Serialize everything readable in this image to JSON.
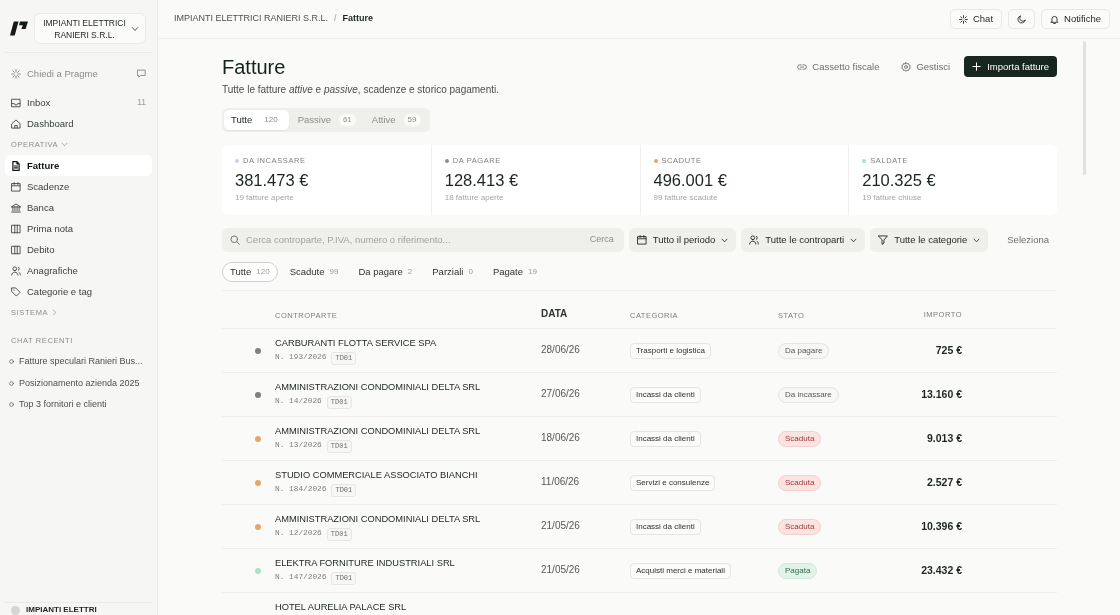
{
  "sidebar": {
    "company": {
      "name": "IMPIANTI ELETTRICI RANIERI S.R.L."
    },
    "ask": {
      "label": "Chiedi a Pragme"
    },
    "items": [
      {
        "label": "Inbox",
        "count": "11",
        "selected": false
      },
      {
        "label": "Dashboard",
        "selected": false
      }
    ],
    "sections": [
      {
        "title": "OPERATIVA",
        "expanded": true,
        "items": [
          {
            "label": "Fatture",
            "selected": true
          },
          {
            "label": "Scadenze",
            "selected": false
          },
          {
            "label": "Banca",
            "selected": false
          },
          {
            "label": "Prima nota",
            "selected": false
          },
          {
            "label": "Debito",
            "selected": false
          },
          {
            "label": "Anagrafiche",
            "selected": false
          },
          {
            "label": "Categorie e tag",
            "selected": false
          }
        ]
      },
      {
        "title": "SISTEMA",
        "expanded": false
      }
    ],
    "recent_chats": {
      "title": "CHAT RECENTI",
      "items": [
        "Fatture speculari Ranieri Bus...",
        "Posizionamento azienda 2025",
        "Top 3 fornitori e clienti"
      ]
    },
    "account": {
      "label": "IMPIANTI ELETTRI"
    }
  },
  "header": {
    "breadcrumb": [
      "IMPIANTI ELETTRICI RANIERI S.R.L.",
      "Fatture"
    ],
    "separator": "/",
    "chat_button": "Chat",
    "notifications_button": "Notifiche"
  },
  "page": {
    "title": "Fatture",
    "subtitle": "Tutte le fatture *attive* e *passive*, scadenze e storico pagamenti.",
    "actions": [
      {
        "label": "Cassetto fiscale",
        "kind": "link"
      },
      {
        "label": "Gestisci",
        "kind": "link"
      },
      {
        "label": "Importa fatture",
        "kind": "primary"
      }
    ]
  },
  "type_tabs": [
    {
      "label": "Tutte",
      "count": "120",
      "selected": true
    },
    {
      "label": "Passive",
      "count": "61",
      "selected": false
    },
    {
      "label": "Attive",
      "count": "59",
      "selected": false
    }
  ],
  "summary": [
    {
      "label": "DA INCASSARE",
      "value": "381.473 €",
      "note": "19 fatture aperte",
      "color": "#c8d2df"
    },
    {
      "label": "DA PAGARE",
      "value": "128.413 €",
      "note": "18 fatture aperte",
      "color": "#8c8f8d"
    },
    {
      "label": "SCADUTE",
      "value": "496.001 €",
      "note": "99 fatture scadute",
      "color": "#e8a46f"
    },
    {
      "label": "SALDATE",
      "value": "210.325 €",
      "note": "19 fatture chiuse",
      "color": "#a9dfcb"
    }
  ],
  "filters": {
    "search": {
      "placeholder": "Cerca controparte, P.IVA, numero o riferimento...",
      "button": "Cerca"
    },
    "dropdowns": [
      {
        "label": "Tutto il periodo"
      },
      {
        "label": "Tutte le controparti"
      },
      {
        "label": "Tutte le categorie"
      }
    ],
    "select_button": "Seleziona"
  },
  "status_tabs": [
    {
      "label": "Tutte",
      "count": "120",
      "selected": true
    },
    {
      "label": "Scadute",
      "count": "99",
      "selected": false
    },
    {
      "label": "Da pagare",
      "count": "2",
      "selected": false
    },
    {
      "label": "Parziali",
      "count": "0",
      "selected": false
    },
    {
      "label": "Pagate",
      "count": "19",
      "selected": false
    }
  ],
  "table": {
    "columns": [
      {
        "label": "CONTROPARTE",
        "sorted": false
      },
      {
        "label": "DATA",
        "sorted": true
      },
      {
        "label": "CATEGORIA",
        "sorted": false
      },
      {
        "label": "STATO",
        "sorted": false
      },
      {
        "label": "IMPORTO",
        "sorted": false
      }
    ],
    "rows": [
      {
        "color": "#7d807e",
        "name": "CARBURANTI FLOTTA SERVICE SPA",
        "number": "N. 193/2026",
        "doc_type": "TD01",
        "date": "28/06/26",
        "category": "Trasporti e logistica",
        "status": {
          "label": "Da pagare",
          "kind": "pending"
        },
        "amount": "725 €"
      },
      {
        "color": "#7d807e",
        "name": "AMMINISTRAZIONI CONDOMINIALI DELTA SRL",
        "number": "N. 14/2026",
        "doc_type": "TD01",
        "date": "27/06/26",
        "category": "Incassi da clienti",
        "status": {
          "label": "Da incassare",
          "kind": "pending"
        },
        "amount": "13.160 €"
      },
      {
        "color": "#e8a46f",
        "name": "AMMINISTRAZIONI CONDOMINIALI DELTA SRL",
        "number": "N. 13/2026",
        "doc_type": "TD01",
        "date": "18/06/26",
        "category": "Incassi da clienti",
        "status": {
          "label": "Scaduta",
          "kind": "overdue"
        },
        "amount": "9.013 €"
      },
      {
        "color": "#e8a46f",
        "name": "STUDIO COMMERCIALE ASSOCIATO BIANCHI",
        "number": "N. 184/2026",
        "doc_type": "TD01",
        "date": "11/06/26",
        "category": "Servizi e consulenze",
        "status": {
          "label": "Scaduta",
          "kind": "overdue"
        },
        "amount": "2.527 €"
      },
      {
        "color": "#e8a46f",
        "name": "AMMINISTRAZIONI CONDOMINIALI DELTA SRL",
        "number": "N. 12/2026",
        "doc_type": "TD01",
        "date": "21/05/26",
        "category": "Incassi da clienti",
        "status": {
          "label": "Scaduta",
          "kind": "overdue"
        },
        "amount": "10.396 €"
      },
      {
        "color": "#a9e3c4",
        "name": "ELEKTRA FORNITURE INDUSTRIALI SRL",
        "number": "N. 147/2026",
        "doc_type": "TD01",
        "date": "21/05/26",
        "category": "Acquisti merci e materiali",
        "status": {
          "label": "Pagata",
          "kind": "paid"
        },
        "amount": "23.432 €"
      },
      {
        "name": "HOTEL AURELIA PALACE SRL"
      }
    ]
  }
}
